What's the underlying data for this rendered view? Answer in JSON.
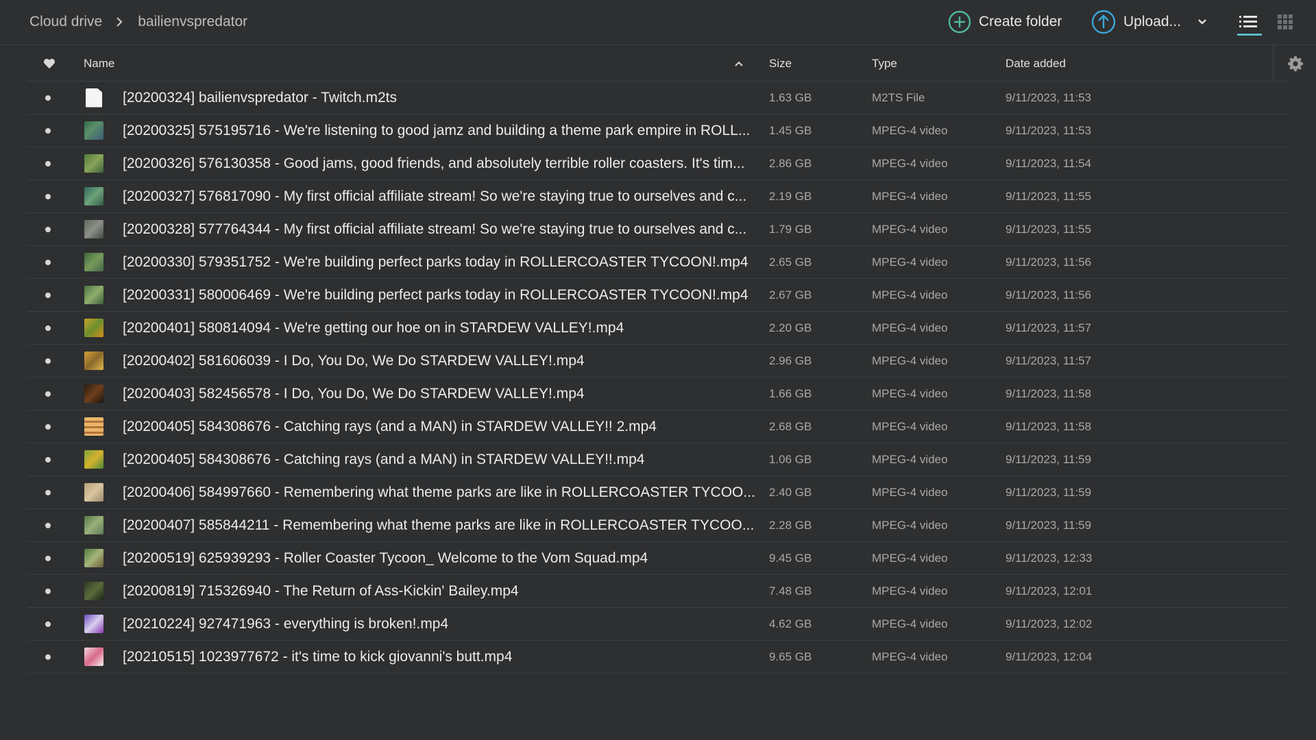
{
  "breadcrumb": {
    "root": "Cloud drive",
    "current": "bailienvspredator"
  },
  "toolbar": {
    "create_folder": "Create folder",
    "upload": "Upload..."
  },
  "columns": {
    "name": "Name",
    "size": "Size",
    "type": "Type",
    "date": "Date added"
  },
  "colors": {
    "accent": "#5bb8c9",
    "create_icon": "#4fb89e",
    "upload_icon": "#3ba8d8"
  },
  "files": [
    {
      "name": "[20200324] bailienvspredator - Twitch.m2ts",
      "size": "1.63 GB",
      "type": "M2TS File",
      "date": "9/11/2023, 11:53",
      "thumb": "file"
    },
    {
      "name": "[20200325] 575195716 - We're listening to good jamz and building a theme park empire in ROLL...",
      "size": "1.45 GB",
      "type": "MPEG-4 video",
      "date": "9/11/2023, 11:53",
      "thumb": "linear-gradient(135deg,#2f6b4a,#5a8f6a 40%,#3d5c75)"
    },
    {
      "name": "[20200326] 576130358 - Good jams, good friends, and absolutely terrible roller coasters. It's tim...",
      "size": "2.86 GB",
      "type": "MPEG-4 video",
      "date": "9/11/2023, 11:54",
      "thumb": "linear-gradient(135deg,#4f7a3a,#8aa45a 50%,#3b5f3b)"
    },
    {
      "name": "[20200327] 576817090 - My first official affiliate stream! So we're staying true to ourselves and c...",
      "size": "2.19 GB",
      "type": "MPEG-4 video",
      "date": "9/11/2023, 11:55",
      "thumb": "linear-gradient(135deg,#2d6a5a,#6ea27a 50%,#2f5b46)"
    },
    {
      "name": "[20200328] 577764344 - My first official affiliate stream! So we're staying true to ourselves and c...",
      "size": "1.79 GB",
      "type": "MPEG-4 video",
      "date": "9/11/2023, 11:55",
      "thumb": "linear-gradient(135deg,#5d6b5f,#8d8f88 50%,#3f4a42)"
    },
    {
      "name": "[20200330] 579351752 - We're building perfect parks today in ROLLERCOASTER TYCOON!.mp4",
      "size": "2.65 GB",
      "type": "MPEG-4 video",
      "date": "9/11/2023, 11:56",
      "thumb": "linear-gradient(135deg,#3e6b3e,#77995a 50%,#446a4c)"
    },
    {
      "name": "[20200331] 580006469 - We're building perfect parks today in ROLLERCOASTER TYCOON!.mp4",
      "size": "2.67 GB",
      "type": "MPEG-4 video",
      "date": "9/11/2023, 11:56",
      "thumb": "linear-gradient(135deg,#4b7245,#8fae6d 50%,#3c5c3a)"
    },
    {
      "name": "[20200401] 580814094 - We're getting our hoe on in STARDEW VALLEY!.mp4",
      "size": "2.20 GB",
      "type": "MPEG-4 video",
      "date": "9/11/2023, 11:57",
      "thumb": "linear-gradient(135deg,#c9a227,#6b8f2c 50%,#d88f20)"
    },
    {
      "name": "[20200402] 581606039 - I Do, You Do, We Do STARDEW VALLEY!.mp4",
      "size": "2.96 GB",
      "type": "MPEG-4 video",
      "date": "9/11/2023, 11:57",
      "thumb": "linear-gradient(135deg,#d9a03a,#8a6a2a 50%,#e0b64e)"
    },
    {
      "name": "[20200403] 582456578 - I Do, You Do, We Do STARDEW VALLEY!.mp4",
      "size": "1.66 GB",
      "type": "MPEG-4 video",
      "date": "9/11/2023, 11:58",
      "thumb": "linear-gradient(135deg,#2a1c12,#6e3f1c 50%,#1c140e)"
    },
    {
      "name": "[20200405] 584308676 - Catching rays (and a MAN) in STARDEW VALLEY!! 2.mp4",
      "size": "2.68 GB",
      "type": "MPEG-4 video",
      "date": "9/11/2023, 11:58",
      "thumb": "repeating-linear-gradient(180deg,#e8b66a 0 5px,#b5733a 5px 8px)"
    },
    {
      "name": "[20200405] 584308676 - Catching rays (and a MAN) in STARDEW VALLEY!!.mp4",
      "size": "1.06 GB",
      "type": "MPEG-4 video",
      "date": "9/11/2023, 11:59",
      "thumb": "linear-gradient(135deg,#7fa33a,#d5b22e 50%,#4d8a3a)"
    },
    {
      "name": "[20200406] 584997660 - Remembering what theme parks are like in ROLLERCOASTER TYCOO...",
      "size": "2.40 GB",
      "type": "MPEG-4 video",
      "date": "9/11/2023, 11:59",
      "thumb": "linear-gradient(135deg,#b9a07a,#d8c5a0 50%,#9a8a6a)"
    },
    {
      "name": "[20200407] 585844211 - Remembering what theme parks are like in ROLLERCOASTER TYCOO...",
      "size": "2.28 GB",
      "type": "MPEG-4 video",
      "date": "9/11/2023, 11:59",
      "thumb": "linear-gradient(135deg,#4f7a4a,#9ab07a 50%,#5a7a55)"
    },
    {
      "name": "[20200519] 625939293 - Roller Coaster Tycoon_ Welcome to the Vom Squad.mp4",
      "size": "9.45 GB",
      "type": "MPEG-4 video",
      "date": "9/11/2023, 12:33",
      "thumb": "linear-gradient(135deg,#4a7a3f,#a8b57a 50%,#6a5a3a)"
    },
    {
      "name": "[20200819] 715326940 - The Return of Ass-Kickin' Bailey.mp4",
      "size": "7.48 GB",
      "type": "MPEG-4 video",
      "date": "9/11/2023, 12:01",
      "thumb": "linear-gradient(135deg,#2f3a22,#5a6a3a 50%,#1e2618)"
    },
    {
      "name": "[20210224] 927471963 - everything is broken!.mp4",
      "size": "4.62 GB",
      "type": "MPEG-4 video",
      "date": "9/11/2023, 12:02",
      "thumb": "linear-gradient(135deg,#6a4ac0,#d8d0f0 50%,#8a3ab0)"
    },
    {
      "name": "[20210515] 1023977672 - it's time to kick giovanni's butt.mp4",
      "size": "9.65 GB",
      "type": "MPEG-4 video",
      "date": "9/11/2023, 12:04",
      "thumb": "linear-gradient(135deg,#f0d8e0,#d86a8a 50%,#f5eef0)"
    }
  ]
}
